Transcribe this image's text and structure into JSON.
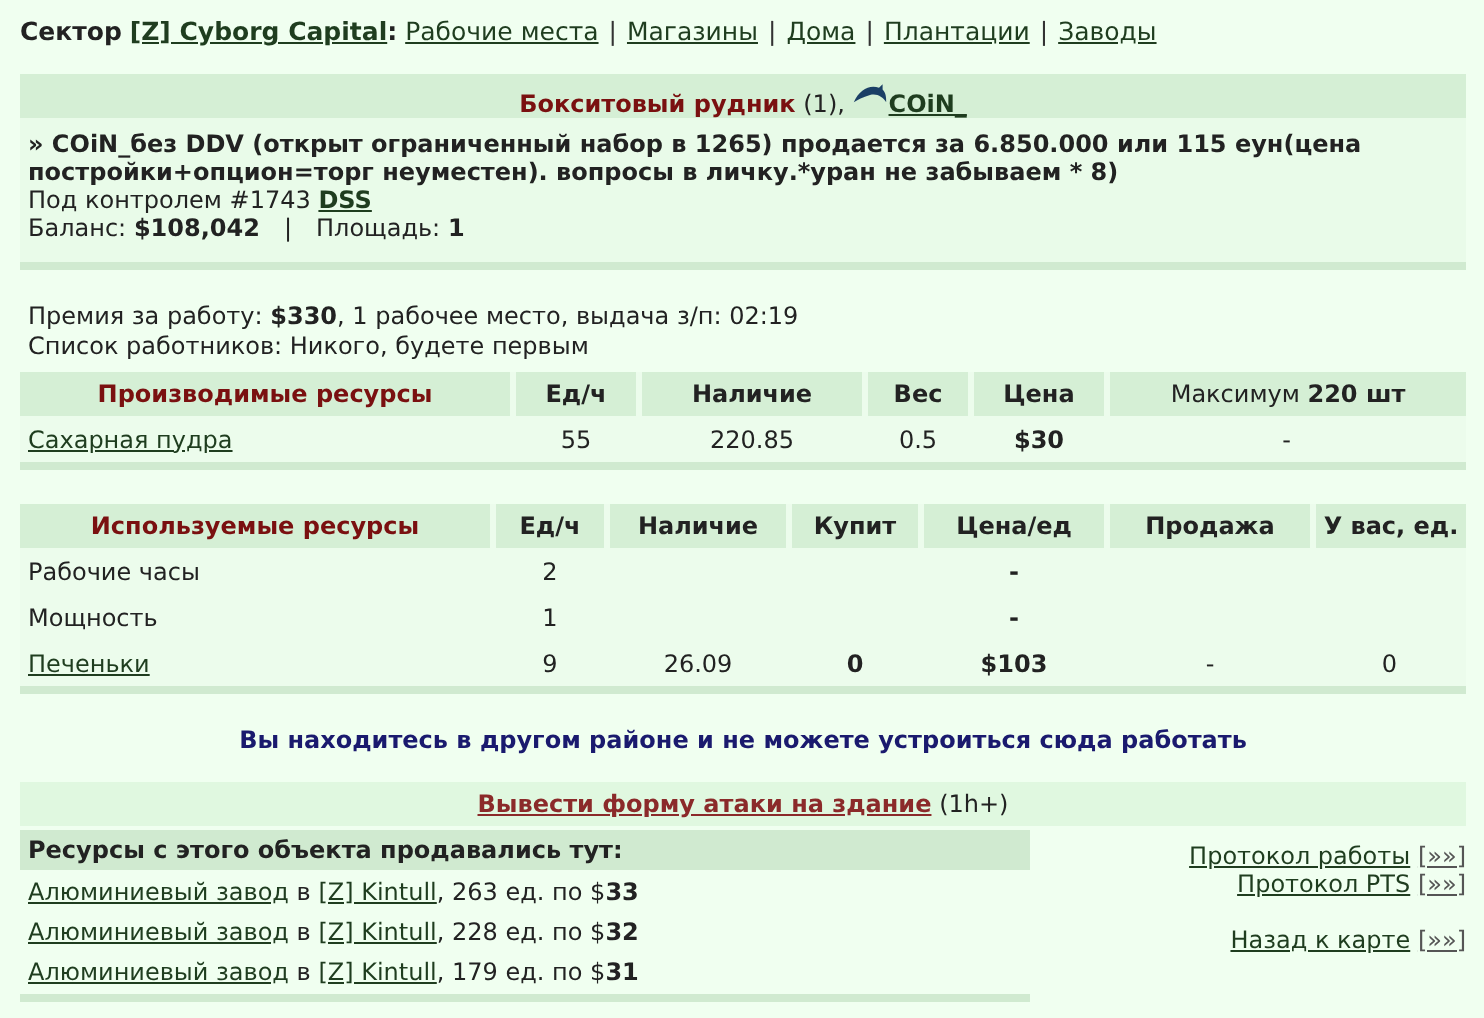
{
  "nav": {
    "label": "Сектор",
    "sector": "[Z] Cyborg Capital",
    "colon": ":",
    "separator": "|",
    "links": [
      "Рабочие места",
      "Магазины",
      "Дома",
      "Плантации",
      "Заводы"
    ]
  },
  "building": {
    "title": "Бокситовый рудник",
    "count": "(1),",
    "owner": "COiN_"
  },
  "description": "» COiN_без DDV (открыт ограниченный набор в 1265) продается за 6.850.000 или 115 еун(цена постройки+опцион=торг неуместен). вопросы в личку.*уран не забываем * 8)",
  "control": {
    "label": "Под контролем #1743",
    "owner": "DSS"
  },
  "balance": {
    "label": "Баланс:",
    "value": "$108,042",
    "separator": "|",
    "area_label": "Площадь:",
    "area": "1"
  },
  "bonus": "Премия за работу: **$330**, 1 рабочее место, выдача з/п: 02:19",
  "workers": "Список работников: Никого, будете первым",
  "produced": {
    "columns": [
      "Производимые ресурсы",
      "Ед/ч",
      "Наличие",
      "Вес",
      "Цена",
      "Максимум **220 шт**"
    ],
    "rows": [
      {
        "link": true,
        "cells": [
          "Сахарная пудра",
          "55",
          "220.85",
          "0.5",
          "$30",
          "-"
        ]
      }
    ]
  },
  "used": {
    "columns": [
      "Используемые ресурсы",
      "Ед/ч",
      "Наличие",
      "Купит",
      "Цена/ед",
      "Продажа",
      "У вас, ед."
    ],
    "rows": [
      {
        "link": false,
        "cells": [
          "Рабочие часы",
          "2",
          "",
          "",
          "-",
          "",
          ""
        ]
      },
      {
        "link": false,
        "cells": [
          "Мощность",
          "1",
          "",
          "",
          "-",
          "",
          ""
        ]
      },
      {
        "link": true,
        "cells": [
          "Печеньки",
          "9",
          "26.09",
          "0",
          "$103",
          "-",
          "0"
        ]
      }
    ]
  },
  "notice": "Вы находитесь в другом районе и не можете устроиться сюда работать",
  "attack": {
    "link": "Вывести форму атаки на здание",
    "suffix": "(1h+)"
  },
  "sales": {
    "title": "Ресурсы с этого объекта продавались тут:",
    "rows": [
      {
        "building": "Алюминиевый завод",
        "in": "в",
        "sector": "[Z] Kintull",
        "rest": ", 263 ед. по $**33**"
      },
      {
        "building": "Алюминиевый завод",
        "in": "в",
        "sector": "[Z] Kintull",
        "rest": ", 228 ед. по $**32**"
      },
      {
        "building": "Алюминиевый завод",
        "in": "в",
        "sector": "[Z] Kintull",
        "rest": ", 179 ед. по $**31**"
      }
    ]
  },
  "side_link_groups": [
    {
      "links": [
        {
          "label": "Протокол работы",
          "more": "[»»]"
        },
        {
          "label": "Протокол PTS",
          "more": "[»»]"
        }
      ]
    },
    {
      "links": [
        {
          "label": "Назад к карте",
          "more": "[»»]"
        }
      ]
    }
  ]
}
